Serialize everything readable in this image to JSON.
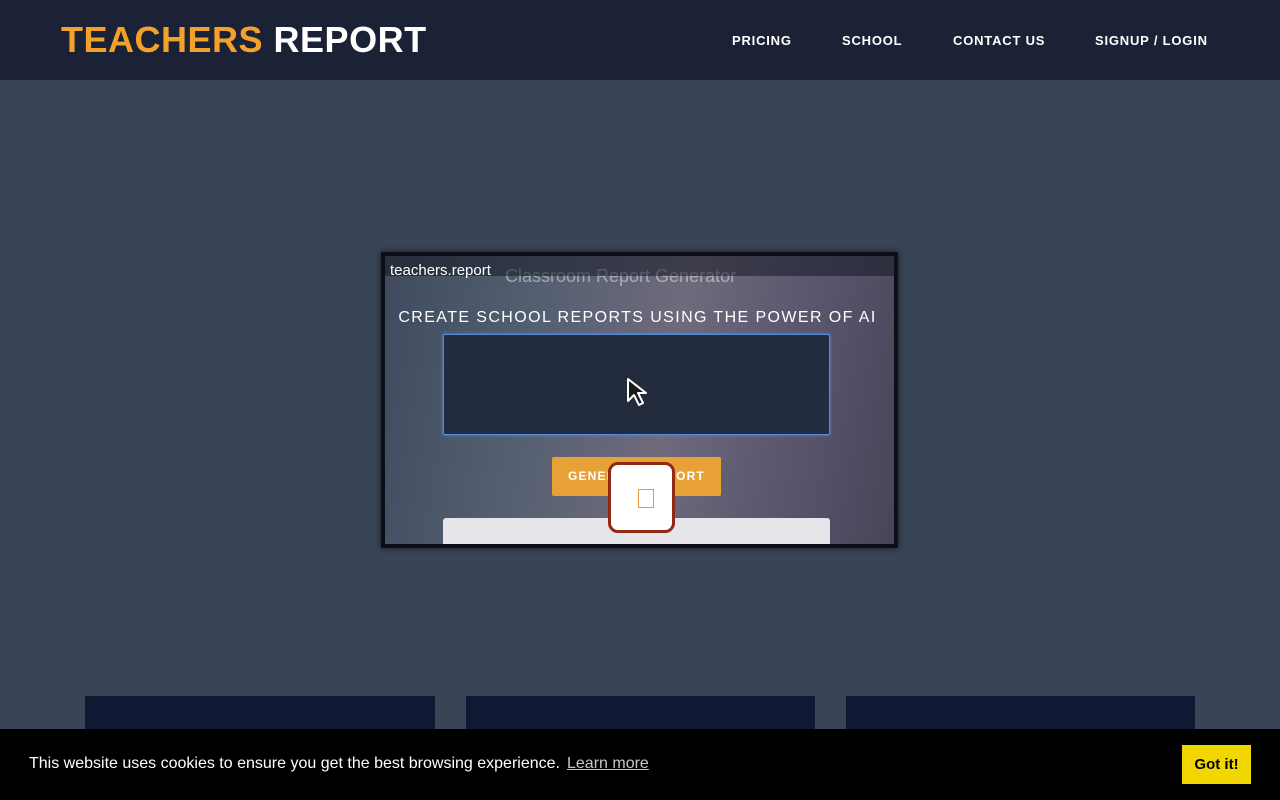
{
  "header": {
    "logo_primary": "TEACHERS",
    "logo_secondary": "REPORT",
    "nav": [
      "PRICING",
      "SCHOOL",
      "CONTACT US",
      "SIGNUP / LOGIN"
    ]
  },
  "video": {
    "brand": "teachers.report",
    "ghost_title": "Classroom Report Generator",
    "heading": "CREATE SCHOOL REPORTS USING THE POWER OF AI",
    "button_label": "GENERATE REPORT",
    "cursor_icon": "mouse-pointer-icon",
    "play_icon": "play-icon"
  },
  "cookie": {
    "message": "This website uses cookies to ensure you get the best browsing experience.",
    "learn_more": "Learn more",
    "accept": "Got it!"
  },
  "colors": {
    "navbar": "#1b2235",
    "page_bg": "#3a4457",
    "accent_orange": "#f2a22a",
    "cookie_button": "#f1d600",
    "feature_card": "#111833"
  }
}
